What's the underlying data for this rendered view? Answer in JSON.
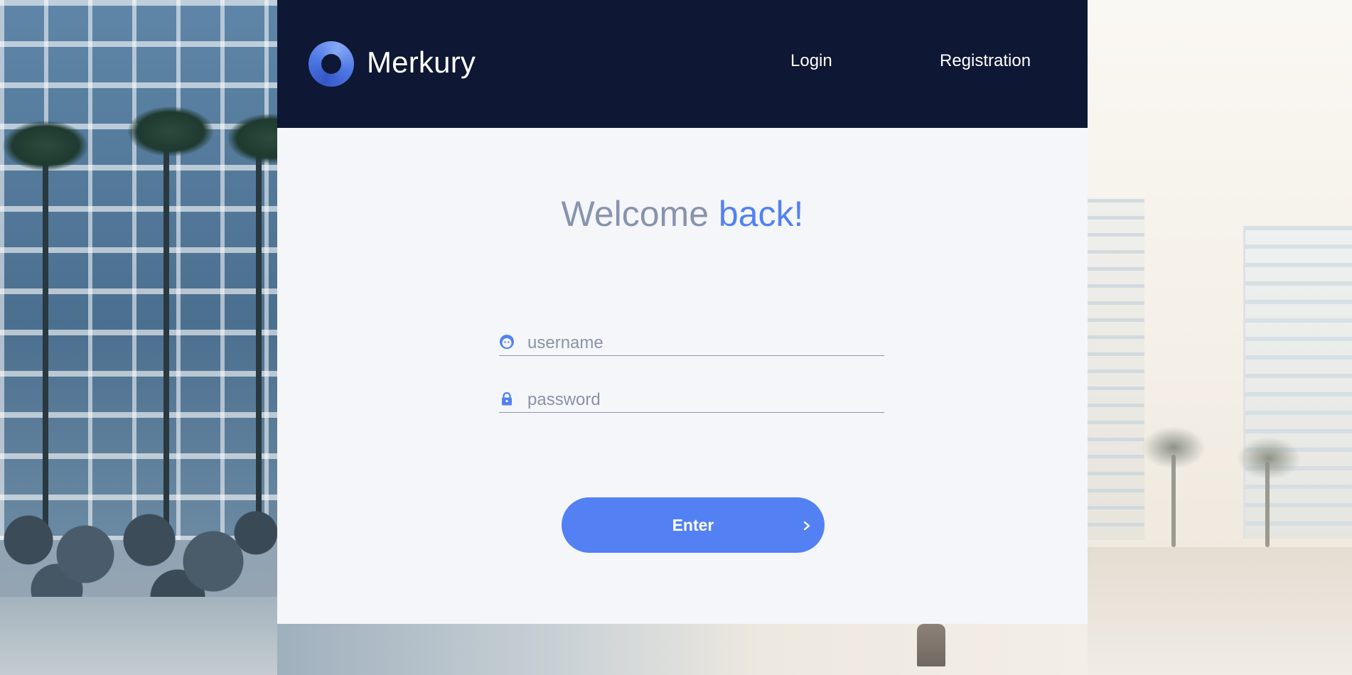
{
  "header": {
    "brand": "Merkury",
    "nav": {
      "login": "Login",
      "registration": "Registration"
    }
  },
  "main": {
    "welcome_part1": "Welcome ",
    "welcome_part2": "back!",
    "username": {
      "placeholder": "username",
      "value": "",
      "icon": "user-icon"
    },
    "password": {
      "placeholder": "password",
      "value": "",
      "icon": "lock-icon"
    },
    "enter_label": "Enter"
  },
  "colors": {
    "header_bg": "#0e1733",
    "accent": "#5381f4",
    "muted_text": "#8893ad",
    "card_bg": "#f5f6f9"
  }
}
